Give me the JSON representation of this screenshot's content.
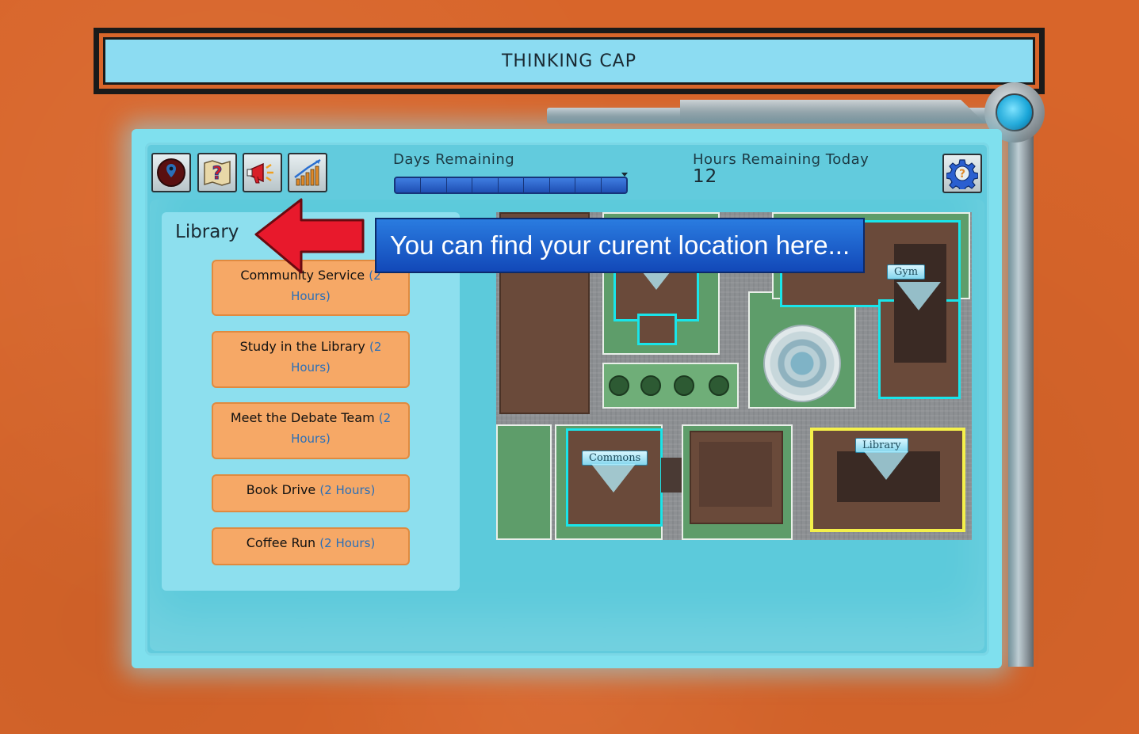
{
  "title": "THINKING CAP",
  "toolbar": {
    "buttons": [
      {
        "name": "location-button",
        "icon": "map-pin-icon"
      },
      {
        "name": "help-map-button",
        "icon": "question-map-icon"
      },
      {
        "name": "announcements-button",
        "icon": "megaphone-icon"
      },
      {
        "name": "stats-button",
        "icon": "bar-chart-icon"
      }
    ],
    "days_label": "Days Remaining",
    "days_progress": 1.0,
    "hours_label": "Hours Remaining Today",
    "hours_value": "12",
    "settings_icon": "gear-question-icon"
  },
  "location": {
    "name": "Library",
    "activities": [
      {
        "label": "Community Service",
        "hours": "(2 Hours)"
      },
      {
        "label": "Study in the Library",
        "hours": "(2 Hours)"
      },
      {
        "label": "Meet the Debate Team",
        "hours": "(2 Hours)"
      },
      {
        "label": "Book Drive",
        "hours": "(2 Hours)"
      },
      {
        "label": "Coffee Run",
        "hours": "(2 Hours)"
      }
    ]
  },
  "map": {
    "labels": {
      "gym": "Gym",
      "commons": "Commons",
      "library": "Library"
    },
    "highlight_colors": {
      "available": "#19e5ea",
      "current": "#f4f04a"
    }
  },
  "tutorial": {
    "message": "You can find your curent location here..."
  },
  "colors": {
    "background": "#d8652a",
    "panel": "#62cbdd",
    "activity_button": "#f6a866",
    "tip_box": "#1e5fd0",
    "arrow": "#e8192c"
  }
}
